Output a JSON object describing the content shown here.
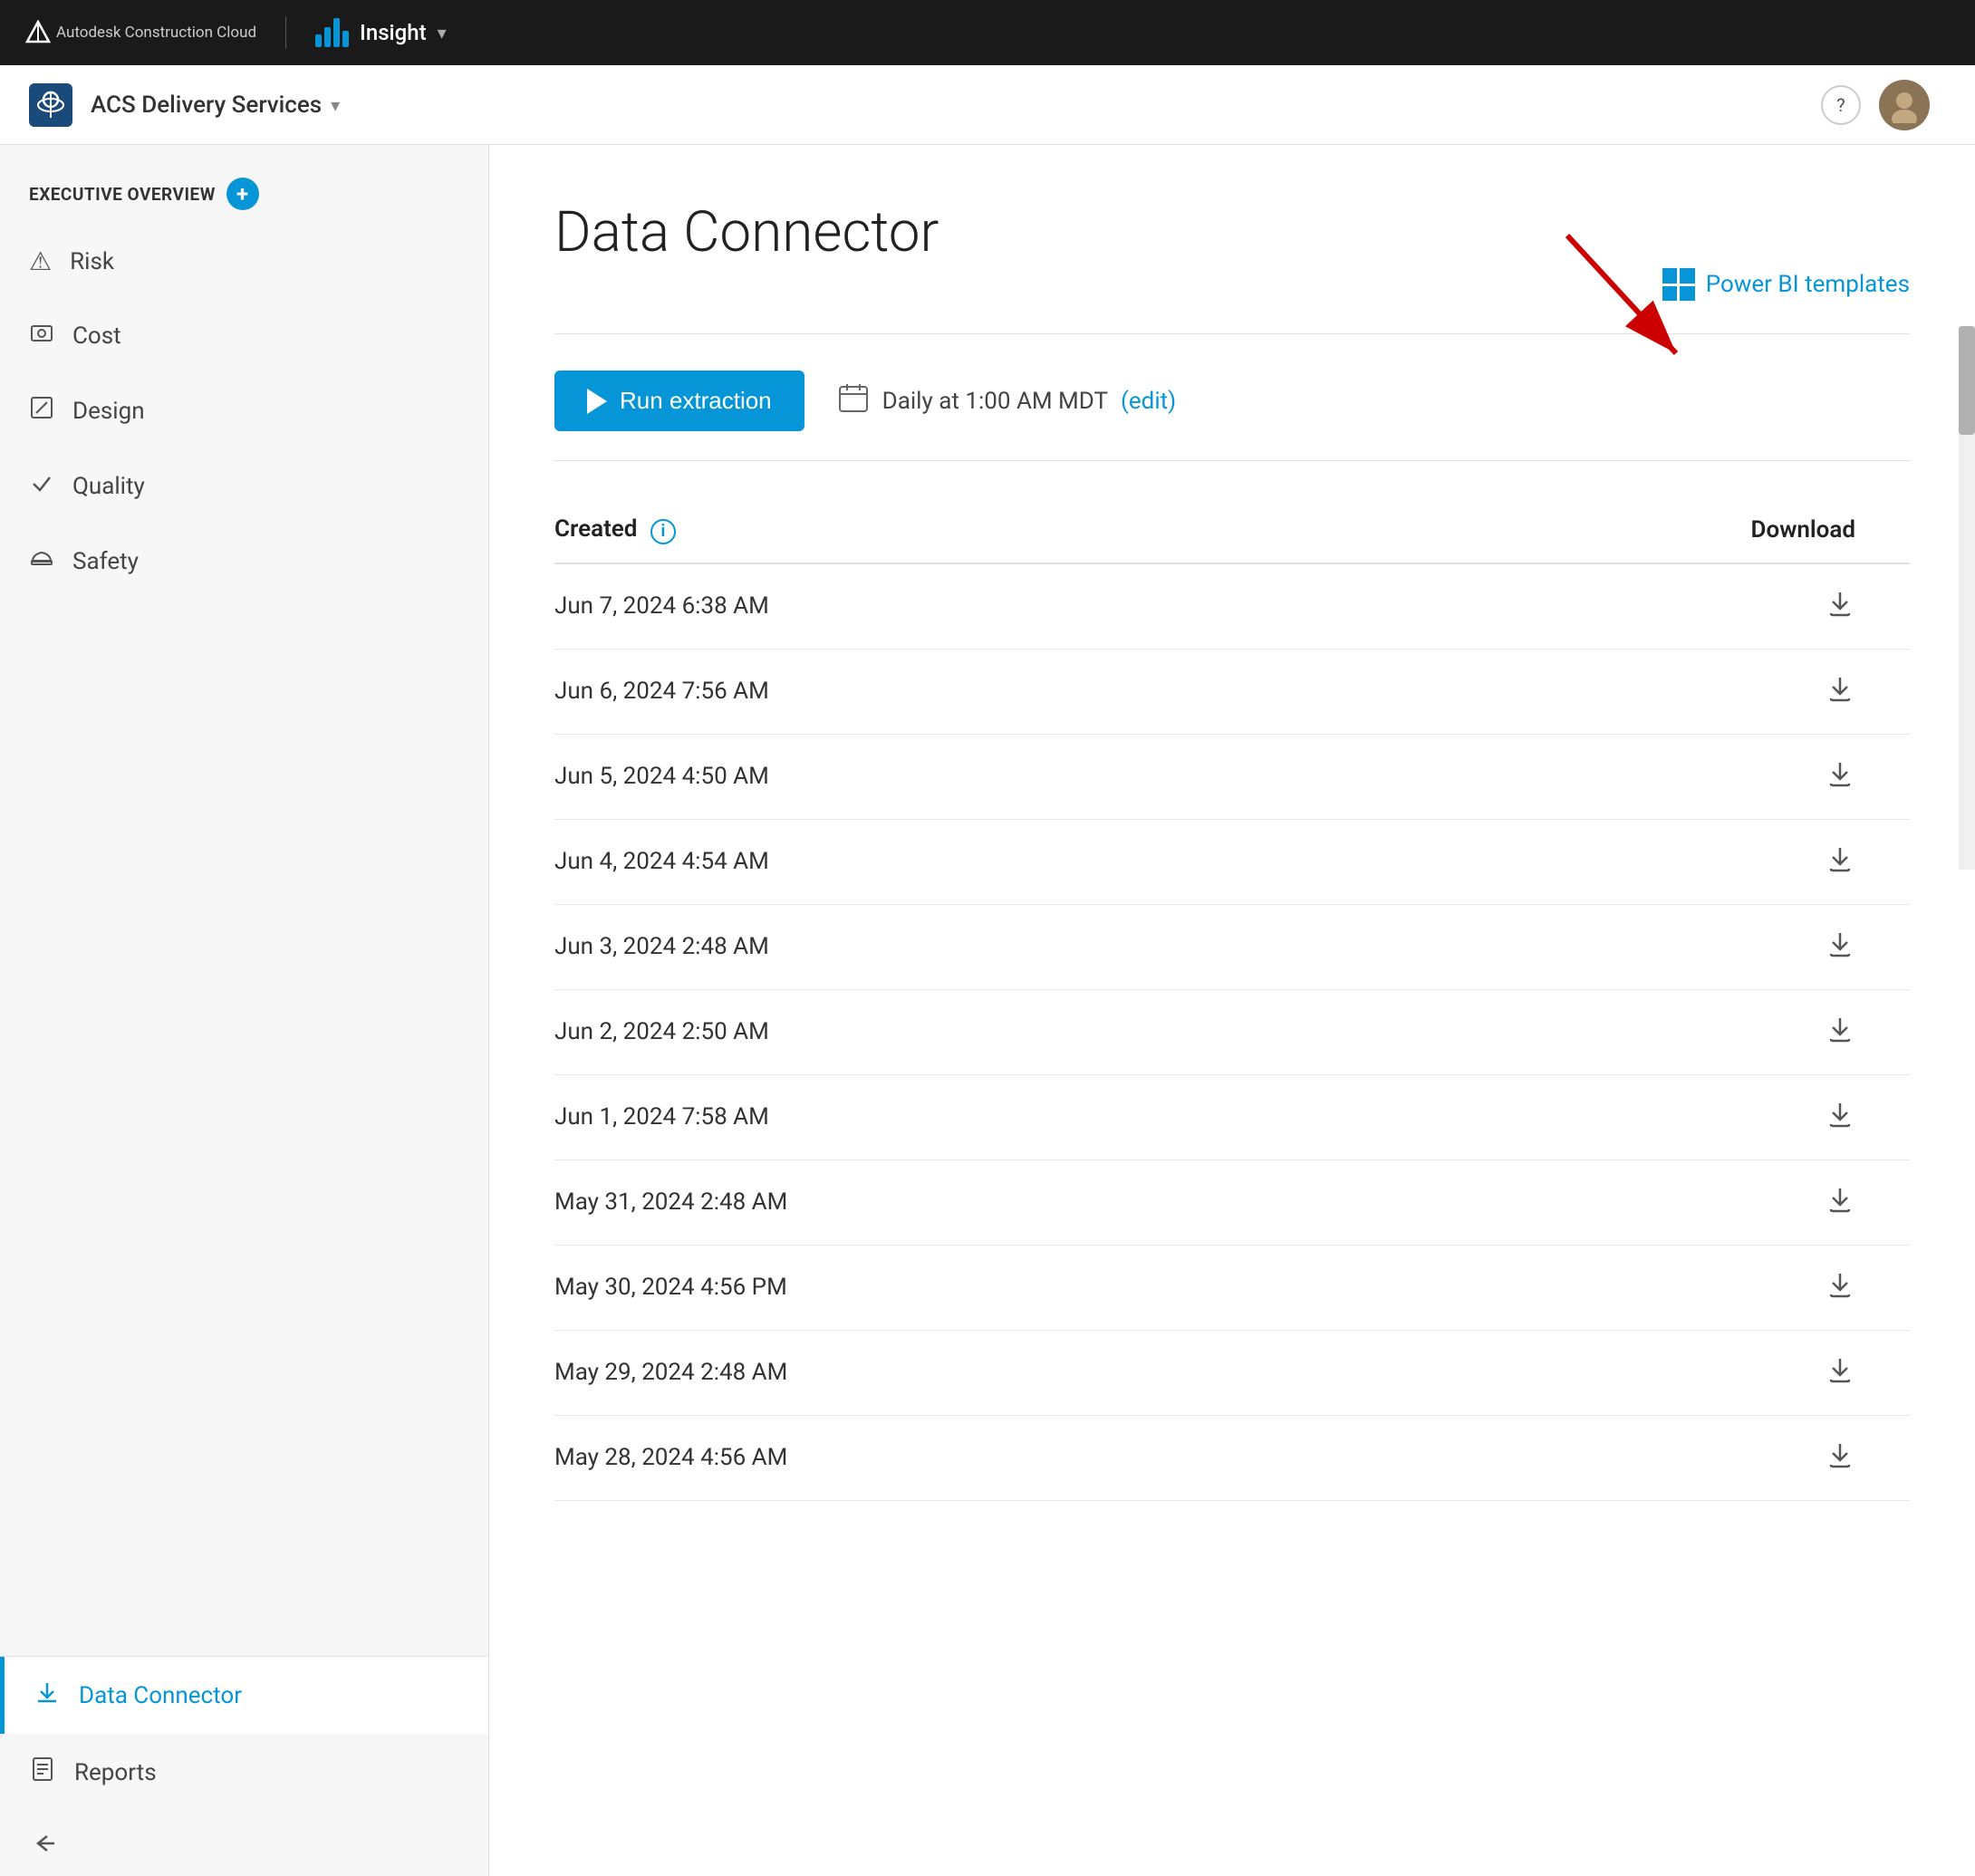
{
  "app": {
    "brand": "Autodesk Construction Cloud",
    "name": "Insight",
    "dropdown_arrow": "▾"
  },
  "header": {
    "project_name": "ACS Delivery Services",
    "dropdown_arrow": "▾",
    "help_label": "?",
    "avatar_initials": "👤"
  },
  "sidebar": {
    "section_label": "EXECUTIVE OVERVIEW",
    "add_button": "+",
    "nav_items": [
      {
        "label": "Risk",
        "icon": "⚠"
      },
      {
        "label": "Cost",
        "icon": "⊟"
      },
      {
        "label": "Design",
        "icon": "✏"
      },
      {
        "label": "Quality",
        "icon": "✓"
      },
      {
        "label": "Safety",
        "icon": "⛑"
      }
    ],
    "bottom_items": [
      {
        "label": "Data Connector",
        "icon": "⬇",
        "active": true
      },
      {
        "label": "Reports",
        "icon": "📋",
        "active": false
      }
    ],
    "collapse_icon": "←"
  },
  "main": {
    "title": "Data Connector",
    "power_bi_label": "Power BI templates",
    "run_btn_label": "Run extraction",
    "schedule_label": "Daily at 1:00 AM MDT",
    "edit_label": "(edit)",
    "table": {
      "col_created": "Created",
      "col_download": "Download",
      "rows": [
        {
          "created": "Jun 7, 2024 6:38 AM"
        },
        {
          "created": "Jun 6, 2024 7:56 AM"
        },
        {
          "created": "Jun 5, 2024 4:50 AM"
        },
        {
          "created": "Jun 4, 2024 4:54 AM"
        },
        {
          "created": "Jun 3, 2024 2:48 AM"
        },
        {
          "created": "Jun 2, 2024 2:50 AM"
        },
        {
          "created": "Jun 1, 2024 7:58 AM"
        },
        {
          "created": "May 31, 2024 2:48 AM"
        },
        {
          "created": "May 30, 2024 4:56 PM"
        },
        {
          "created": "May 29, 2024 2:48 AM"
        },
        {
          "created": "May 28, 2024 4:56 AM"
        }
      ]
    }
  },
  "colors": {
    "accent": "#0696d7",
    "topbar_bg": "#1a1a1a",
    "sidebar_bg": "#f7f7f7",
    "active_color": "#0696d7",
    "arrow_color": "#e00"
  }
}
